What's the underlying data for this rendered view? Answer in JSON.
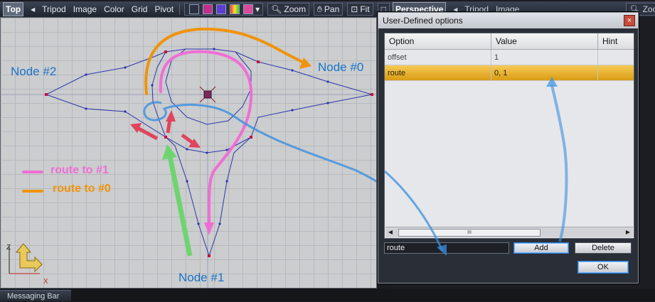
{
  "viewport": {
    "label": "Top",
    "menu": [
      "Tripod",
      "Image",
      "Color",
      "Grid",
      "Pivot"
    ],
    "tools": [
      "Zoom",
      "Pan",
      "Fit"
    ]
  },
  "viewport_right": {
    "label": "Perspective",
    "menu": [
      "Tripod",
      "Image"
    ],
    "tools": [
      "Zoom"
    ]
  },
  "nodes": [
    {
      "name": "Node #0"
    },
    {
      "name": "Node #1"
    },
    {
      "name": "Node #2"
    }
  ],
  "legend": [
    {
      "label": "route to #1",
      "color": "#f06ed4"
    },
    {
      "label": "route to #0",
      "color": "#f0930a"
    }
  ],
  "axes": {
    "z": "Z",
    "x": "X"
  },
  "dialog": {
    "title": "User-Defined options",
    "close": "×",
    "columns": [
      "Option",
      "Value",
      "Hint"
    ],
    "rows": [
      {
        "option": "offset",
        "value": "1",
        "hint": "",
        "selected": false
      },
      {
        "option": "route",
        "value": "0, 1",
        "hint": "",
        "selected": true
      }
    ],
    "scroll_thumb": "III",
    "input_value": "route",
    "add_label": "Add",
    "delete_label": "Delete",
    "ok_label": "OK"
  },
  "messaging_bar": "Messaging Bar",
  "colors": {
    "mesh": "#2d36a8",
    "vertex": "#c8103e",
    "pink_route": "#f06ed4",
    "orange_route": "#f0930a",
    "green_arrow": "#6fd46f",
    "blue_annotation": "#3a8fe0",
    "selection": "#e5a624"
  }
}
